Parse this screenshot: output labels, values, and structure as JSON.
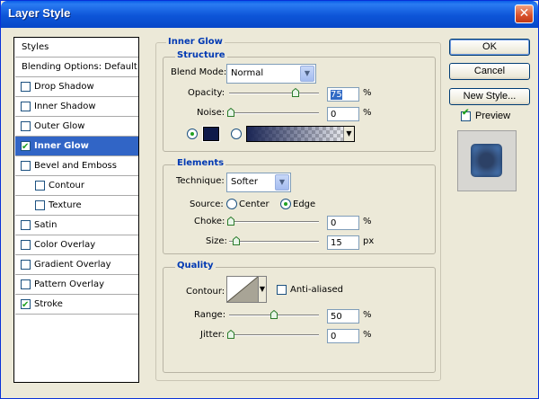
{
  "window": {
    "title": "Layer Style",
    "close_glyph": "✕"
  },
  "styles_list": {
    "items": [
      {
        "label": "Styles",
        "type": "header"
      },
      {
        "label": "Blending Options: Default",
        "type": "header"
      },
      {
        "label": "Drop Shadow",
        "checked": false,
        "indent": 0
      },
      {
        "label": "Inner Shadow",
        "checked": false,
        "indent": 0
      },
      {
        "label": "Outer Glow",
        "checked": false,
        "indent": 0
      },
      {
        "label": "Inner Glow",
        "checked": true,
        "indent": 0,
        "selected": true
      },
      {
        "label": "Bevel and Emboss",
        "checked": false,
        "indent": 0
      },
      {
        "label": "Contour",
        "checked": false,
        "indent": 1
      },
      {
        "label": "Texture",
        "checked": false,
        "indent": 1
      },
      {
        "label": "Satin",
        "checked": false,
        "indent": 0
      },
      {
        "label": "Color Overlay",
        "checked": false,
        "indent": 0
      },
      {
        "label": "Gradient Overlay",
        "checked": false,
        "indent": 0
      },
      {
        "label": "Pattern Overlay",
        "checked": false,
        "indent": 0
      },
      {
        "label": "Stroke",
        "checked": true,
        "indent": 0
      }
    ]
  },
  "buttons": {
    "ok": "OK",
    "cancel": "Cancel",
    "new_style": "New Style...",
    "preview_label": "Preview",
    "preview_checked": true
  },
  "inner_glow": {
    "section_title": "Inner Glow",
    "structure": {
      "title": "Structure",
      "blend_mode_label": "Blend Mode:",
      "blend_mode_value": "Normal",
      "opacity_label": "Opacity:",
      "opacity_value": "75",
      "opacity_level": 0.75,
      "noise_label": "Noise:",
      "noise_value": "0",
      "noise_level": 0,
      "percent": "%",
      "color_swatch": "#0e1a4a",
      "color_mode_selected": "solid"
    },
    "elements": {
      "title": "Elements",
      "technique_label": "Technique:",
      "technique_value": "Softer",
      "source_label": "Source:",
      "source_center": "Center",
      "source_edge": "Edge",
      "source_selected": "edge",
      "choke_label": "Choke:",
      "choke_value": "0",
      "choke_level": 0,
      "size_label": "Size:",
      "size_value": "15",
      "size_level": 0.06,
      "percent": "%",
      "px": "px"
    },
    "quality": {
      "title": "Quality",
      "contour_label": "Contour:",
      "anti_aliased_label": "Anti-aliased",
      "anti_aliased_checked": false,
      "range_label": "Range:",
      "range_value": "50",
      "range_level": 0.5,
      "jitter_label": "Jitter:",
      "jitter_value": "0",
      "jitter_level": 0,
      "percent": "%"
    }
  },
  "colors": {
    "accent": "#0039b3",
    "selection": "#3165c6",
    "title_bar": "#0a5ee8"
  }
}
